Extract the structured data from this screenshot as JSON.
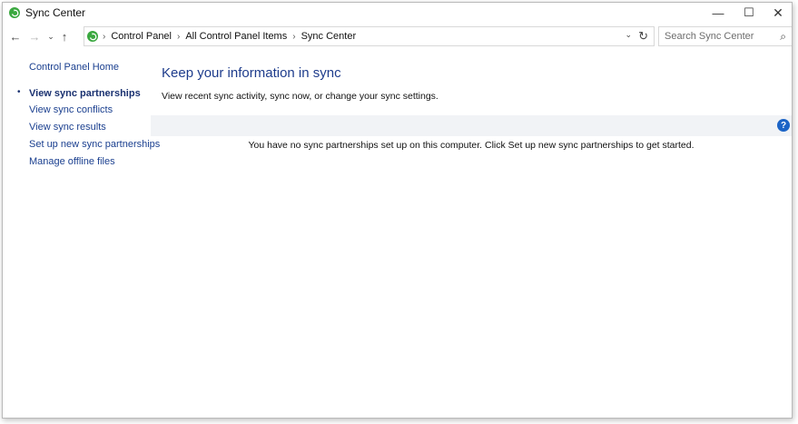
{
  "window": {
    "title": "Sync Center",
    "minimize_glyph": "—",
    "maximize_glyph": "☐",
    "close_glyph": "✕"
  },
  "nav": {
    "back_glyph": "←",
    "forward_glyph": "→",
    "recent_glyph": "⌄",
    "up_glyph": "↑"
  },
  "address": {
    "breadcrumbs": [
      "Control Panel",
      "All Control Panel Items",
      "Sync Center"
    ],
    "separator": "›",
    "dropdown_glyph": "⌄",
    "refresh_glyph": "↻"
  },
  "search": {
    "placeholder": "Search Sync Center",
    "icon_glyph": "⌕"
  },
  "sidebar": {
    "home_label": "Control Panel Home",
    "bullet": "•",
    "items": [
      {
        "label": "View sync partnerships",
        "current": true
      },
      {
        "label": "View sync conflicts",
        "current": false
      },
      {
        "label": "View sync results",
        "current": false
      },
      {
        "label": "Set up new sync partnerships",
        "current": false
      },
      {
        "label": "Manage offline files",
        "current": false
      }
    ]
  },
  "main": {
    "title": "Keep your information in sync",
    "description": "View recent sync activity, sync now, or change your sync settings.",
    "help_glyph": "?",
    "empty_message": "You have no sync partnerships set up on this computer. Click Set up new sync partnerships to get started."
  },
  "colors": {
    "accent": "#3aa83f",
    "link": "#1a3f8f",
    "title": "#1e3c8c",
    "help": "#1c64c6",
    "infobar": "#f1f3f6"
  }
}
